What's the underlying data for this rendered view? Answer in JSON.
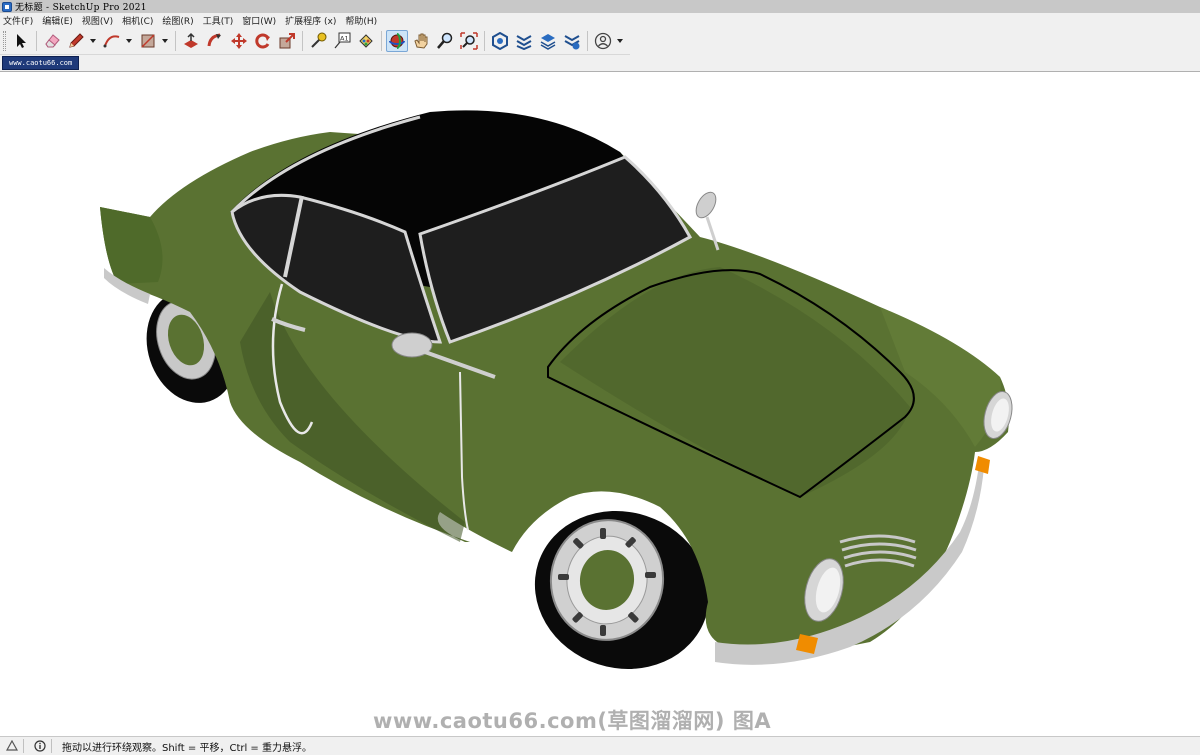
{
  "window": {
    "title": "无标题 - SketchUp Pro 2021"
  },
  "menu": {
    "items": [
      "文件(F)",
      "编辑(E)",
      "视图(V)",
      "相机(C)",
      "绘图(R)",
      "工具(T)",
      "窗口(W)",
      "扩展程序 (x)",
      "帮助(H)"
    ]
  },
  "toolbar": {
    "tools": [
      {
        "name": "select-tool",
        "icon": "arrow-cursor-icon"
      },
      {
        "name": "eraser-tool",
        "icon": "eraser-icon"
      },
      {
        "name": "line-tool",
        "icon": "pencil-icon"
      },
      {
        "name": "arc-tool",
        "icon": "arc-icon"
      },
      {
        "name": "rectangle-tool",
        "icon": "rectangle-icon"
      },
      {
        "name": "push-pull-tool",
        "icon": "push-pull-icon"
      },
      {
        "name": "follow-me-tool",
        "icon": "follow-me-icon"
      },
      {
        "name": "move-tool",
        "icon": "move-arrows-icon"
      },
      {
        "name": "rotate-tool",
        "icon": "rotate-icon"
      },
      {
        "name": "scale-tool",
        "icon": "scale-icon"
      },
      {
        "name": "tape-measure-tool",
        "icon": "tape-measure-icon"
      },
      {
        "name": "text-tool",
        "icon": "text-label-icon"
      },
      {
        "name": "paint-bucket-tool",
        "icon": "paint-bucket-icon"
      },
      {
        "name": "orbit-tool",
        "icon": "orbit-icon",
        "active": true
      },
      {
        "name": "pan-tool",
        "icon": "hand-icon"
      },
      {
        "name": "zoom-tool",
        "icon": "magnifier-icon"
      },
      {
        "name": "zoom-extents-tool",
        "icon": "zoom-extents-icon"
      },
      {
        "name": "warehouse-tool",
        "icon": "3d-warehouse-icon"
      },
      {
        "name": "extension-warehouse-tool",
        "icon": "extension-warehouse-icon"
      },
      {
        "name": "layout-tool",
        "icon": "layers-icon"
      },
      {
        "name": "extension-manager-tool",
        "icon": "extension-manager-icon"
      },
      {
        "name": "account-tool",
        "icon": "user-account-icon"
      }
    ]
  },
  "scene": {
    "tab_label": "www.caotu66.com"
  },
  "viewport": {
    "watermark": "www.caotu66.com(草图溜溜网) 图A",
    "colors": {
      "body": "#5a7232",
      "body_dark": "#3f5424",
      "roof": "#050505",
      "glass": "#1e1e1e",
      "chrome": "#d6d6d6",
      "tire": "#0a0a0a",
      "indicator": "#f08c00"
    }
  },
  "status": {
    "hint": "拖动以进行环绕观察。Shift = 平移，Ctrl = 重力悬浮。"
  }
}
